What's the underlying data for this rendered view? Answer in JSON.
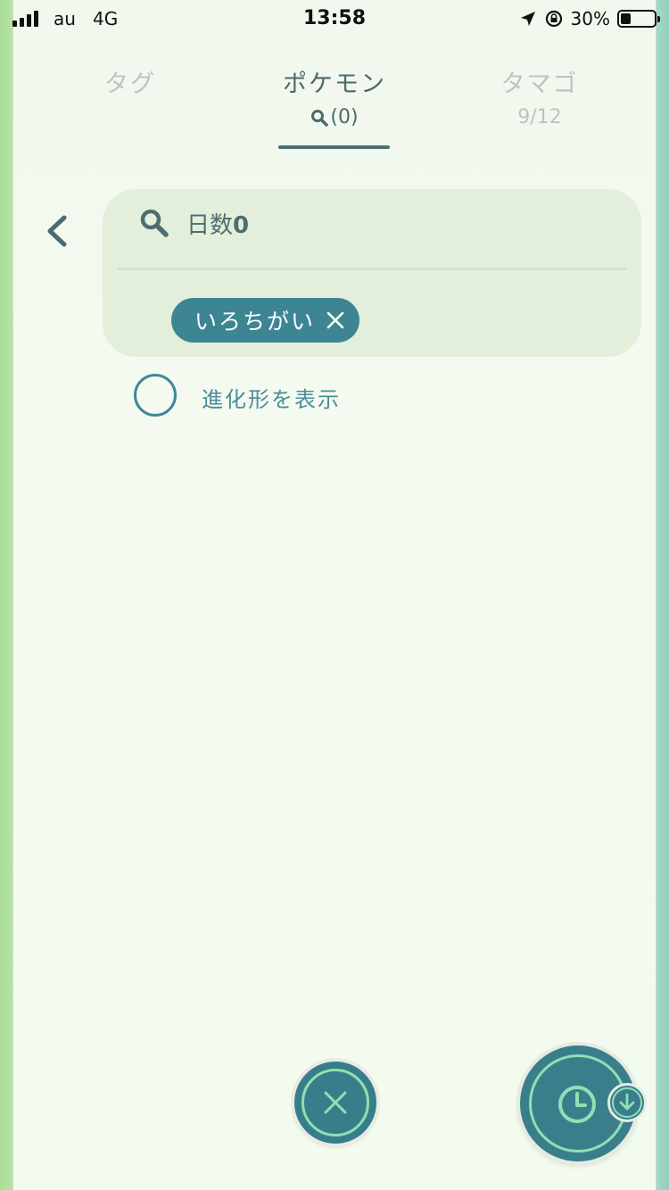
{
  "status_bar": {
    "carrier": "au",
    "network": "4G",
    "time": "13:58",
    "battery_percent_label": "30%",
    "battery_level": 0.3,
    "icons": [
      "signal-icon",
      "location-arrow-icon",
      "orientation-lock-icon",
      "battery-icon"
    ]
  },
  "tabs": [
    {
      "label": "タグ",
      "sub": "",
      "active": false
    },
    {
      "label": "ポケモン",
      "sub": "(0)",
      "active": true
    },
    {
      "label": "タマゴ",
      "sub": "9/12",
      "active": false
    }
  ],
  "search": {
    "icon": "search-icon",
    "query_prefix": "日数",
    "query_value": "0"
  },
  "filter_chips": [
    {
      "label": "いろちがい",
      "remove_icon": "close-icon"
    }
  ],
  "evolution_toggle": {
    "label": "進化形を表示",
    "checked": false
  },
  "buttons": {
    "close": "close-icon",
    "recent": "clock-icon",
    "sort_badge": "arrow-down-icon"
  },
  "colors": {
    "accent": "#3d8593",
    "accent_light": "#8fe0b5",
    "text_primary": "#4c6a6e",
    "text_inactive": "#b8c4c4",
    "card_bg": "#e3eedb"
  }
}
